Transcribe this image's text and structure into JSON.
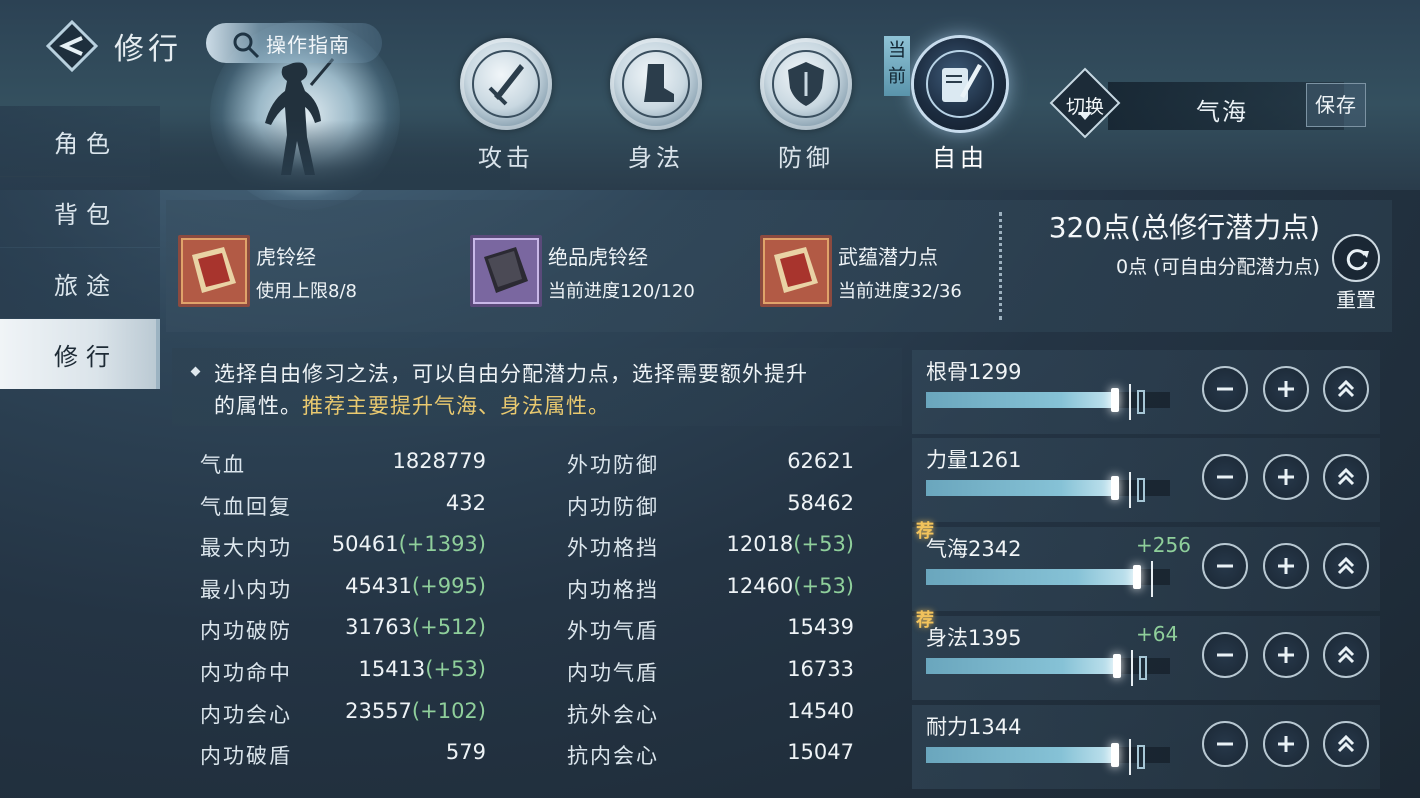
{
  "header": {
    "title": "修行",
    "guide_label": "操作指南"
  },
  "categories": [
    {
      "label": "攻击",
      "icon": "sword-icon"
    },
    {
      "label": "身法",
      "icon": "boot-icon"
    },
    {
      "label": "防御",
      "icon": "shield-icon"
    },
    {
      "label": "自由",
      "icon": "scroll-brush-icon"
    }
  ],
  "current_tag": "当前",
  "switch": {
    "label": "切换",
    "current": "气海",
    "save_label": "保存"
  },
  "sidebar": {
    "items": [
      {
        "label": "角色",
        "active": false
      },
      {
        "label": "背包",
        "active": false
      },
      {
        "label": "旅途",
        "active": false
      },
      {
        "label": "修行",
        "active": true
      }
    ]
  },
  "books": [
    {
      "name": "虎铃经",
      "progress": "使用上限8/8"
    },
    {
      "name": "绝品虎铃经",
      "progress": "当前进度120/120"
    },
    {
      "name": "武蕴潜力点",
      "progress": "当前进度32/36"
    }
  ],
  "potential": {
    "total": "320点(总修行潜力点)",
    "free": "0点 (可自由分配潜力点)",
    "reset_label": "重置"
  },
  "description": {
    "line1": "选择自由修习之法，可以自由分配潜力点，选择需要额外提升",
    "line2_normal": "的属性。",
    "line2_highlight": "推荐主要提升气海、身法属性。"
  },
  "stats": {
    "left": [
      {
        "name": "气血",
        "value": "1828779",
        "bonus": ""
      },
      {
        "name": "气血回复",
        "value": "432",
        "bonus": ""
      },
      {
        "name": "最大内功",
        "value": "50461",
        "bonus": "(+1393)"
      },
      {
        "name": "最小内功",
        "value": "45431",
        "bonus": "(+995)"
      },
      {
        "name": "内功破防",
        "value": "31763",
        "bonus": "(+512)"
      },
      {
        "name": "内功命中",
        "value": "15413",
        "bonus": "(+53)"
      },
      {
        "name": "内功会心",
        "value": "23557",
        "bonus": "(+102)"
      },
      {
        "name": "内功破盾",
        "value": "579",
        "bonus": ""
      }
    ],
    "right": [
      {
        "name": "外功防御",
        "value": "62621",
        "bonus": ""
      },
      {
        "name": "内功防御",
        "value": "58462",
        "bonus": ""
      },
      {
        "name": "外功格挡",
        "value": "12018",
        "bonus": "(+53)"
      },
      {
        "name": "内功格挡",
        "value": "12460",
        "bonus": "(+53)"
      },
      {
        "name": "外功气盾",
        "value": "15439",
        "bonus": ""
      },
      {
        "name": "内功气盾",
        "value": "16733",
        "bonus": ""
      },
      {
        "name": "抗外会心",
        "value": "14540",
        "bonus": ""
      },
      {
        "name": "抗内会心",
        "value": "15047",
        "bonus": ""
      }
    ]
  },
  "attributes": [
    {
      "label": "根骨1299",
      "bonus": "",
      "recommended": false,
      "fill_ratio": 0.79
    },
    {
      "label": "力量1261",
      "bonus": "",
      "recommended": false,
      "fill_ratio": 0.79
    },
    {
      "label": "气海2342",
      "bonus": "+256",
      "recommended": true,
      "fill_ratio": 0.88
    },
    {
      "label": "身法1395",
      "bonus": "+64",
      "recommended": true,
      "fill_ratio": 0.8
    },
    {
      "label": "耐力1344",
      "bonus": "",
      "recommended": false,
      "fill_ratio": 0.79
    }
  ],
  "recommend_mark": "荐",
  "colors": {
    "highlight_text": "#e9c96f",
    "bonus_text": "#8fcf9b",
    "bar_fill": "#86c2d6"
  }
}
